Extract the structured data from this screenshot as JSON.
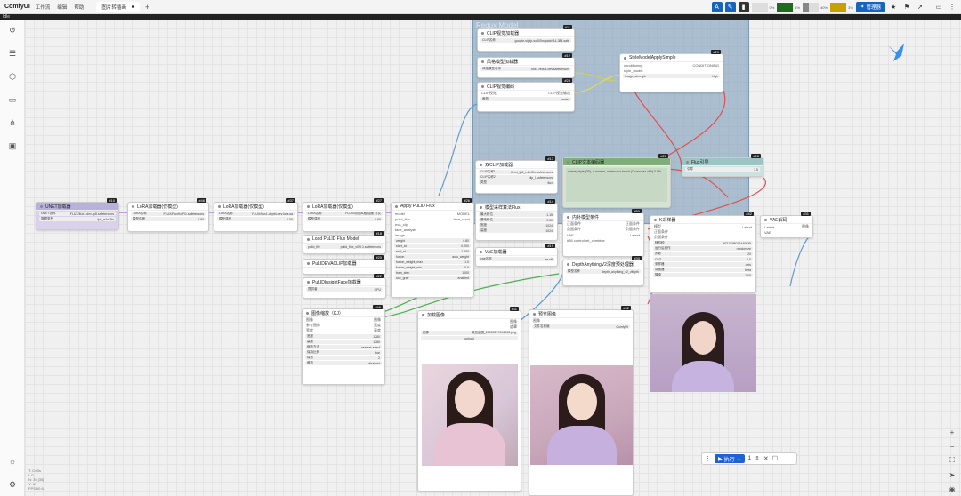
{
  "app": {
    "title": "ComfyUI",
    "menu": [
      "工作流",
      "编辑",
      "帮助"
    ],
    "tab": "图片转插画",
    "strip": "Idle"
  },
  "toolbar": {
    "manager": "管理器",
    "meters": [
      {
        "label": "0%",
        "pct": 0,
        "color": "#1e8e3e"
      },
      {
        "label": "1%",
        "pct": 100,
        "color": "#1e6b1e"
      },
      {
        "label": "40%",
        "pct": 40,
        "color": "#888"
      },
      {
        "label": "3%",
        "pct": 100,
        "color": "#c8a000"
      }
    ]
  },
  "group": {
    "title": "Redux Model"
  },
  "nodes": {
    "unet": {
      "id": "#10",
      "title": "UNET加载器",
      "w1l": "UNET名称",
      "w1v": "FLUX/flux1-dev-fp8.safetensors",
      "w2l": "数据类型",
      "w2v": "fp8_e4m3fn"
    },
    "lora1": {
      "id": "#46",
      "title": "LoRA加载器(仅模型)",
      "w1l": "LoRA名称",
      "w1v": "FLUX/FluxKoiFl1.safetensors",
      "w2l": "模型强度",
      "w2v": "0.60"
    },
    "lora2": {
      "id": "#37",
      "title": "LoRA加载器(仅模型)",
      "w1l": "LoRA名称",
      "w1v": "FLUX/flux1-depth-dev-lora.sa",
      "w2l": "模型强度",
      "w2v": "1.00"
    },
    "lora3": {
      "id": "#27",
      "title": "LoRA加载器(仅模型)",
      "w1l": "LoRA名称",
      "w1v": "FLUX/动漫风格 插画 写实",
      "w2l": "模型强度",
      "w2v": "0.60"
    },
    "pulidload": {
      "id": "#18",
      "title": "Load PuLID Flux Model",
      "w1l": "pulid_file",
      "w1v": "pulid_flux_v0.9.1.safetensors"
    },
    "evaclip": {
      "id": "#20",
      "title": "PuLIDEVACLIP加载器"
    },
    "insight": {
      "id": "#22",
      "title": "PuLIDInsightFace加载器",
      "w1l": "提供者",
      "w1v": "CPU"
    },
    "apply": {
      "id": "#26",
      "title": "Apply PuLID Flux",
      "tag": "1.626秒",
      "ws": [
        [
          "weight",
          "0.80"
        ],
        [
          "start_at",
          "0.000"
        ],
        [
          "end_at",
          "1.000"
        ],
        [
          "fusion",
          "auto_weight"
        ],
        [
          "fusion_weight_max",
          "1.0"
        ],
        [
          "fusion_weight_min",
          "0.0"
        ],
        [
          "train_step",
          "1000"
        ],
        [
          "use_gray",
          "enabled"
        ]
      ]
    },
    "clipload": {
      "id": "#11",
      "title": "CLIP视觉加载器",
      "w1l": "CLIP名称",
      "w1v": "google-siglip-so400m-patch14-384.safe"
    },
    "style": {
      "id": "#12",
      "title": "风格模型加载器",
      "w1l": "风格模型名称",
      "w1v": "flux1-redux-dev.safetensors"
    },
    "clipenc": {
      "id": "#23",
      "title": "CLIP视觉编码",
      "w1l": "裁剪",
      "w1v": "center"
    },
    "styleapply": {
      "id": "#29",
      "title": "StyleModelApplySimple",
      "tag": "#29 AdvancedReflux",
      "w1l": "image_strength",
      "w1v": "high"
    },
    "dualclip": {
      "id": "#13",
      "title": "双CLIP加载器",
      "ws": [
        [
          "CLIP名称1",
          "t5xxl_fp8_e4m3fn.safetensors"
        ],
        [
          "CLIP名称2",
          "clip_l.safetensors"
        ],
        [
          "类型",
          "flux"
        ]
      ]
    },
    "cliptext": {
      "id": "#21",
      "title": "CLIP文本编码器",
      "text": "anime_style (30), a woman, watercolor brush (Crossover of A) 0.9%"
    },
    "guidance": {
      "id": "#28",
      "title": "Flux引导",
      "w1l": "引导",
      "w1v": "3.5"
    },
    "sampler": {
      "id": "#14",
      "title": "模型采样算法Flux",
      "ws": [
        [
          "最大移位",
          "1.15"
        ],
        [
          "基础移位",
          "0.50"
        ],
        [
          "宽度",
          "1024"
        ],
        [
          "高度",
          "1024"
        ]
      ]
    },
    "vae": {
      "id": "#19",
      "title": "VAE加载器",
      "w1l": "vae名称",
      "w1v": "ae.sft"
    },
    "cnapply": {
      "id": "#50",
      "title": "内补模型条件",
      "tag": "0.30秒",
      "extra": "#36 controlnet_combine"
    },
    "depth": {
      "id": "#30",
      "title": "DepthAnythingV2深度预处理器",
      "w1l": "模型名称",
      "w1v": "depth_anything_v2_vitl.pth"
    },
    "ksampler": {
      "id": "#42",
      "title": "K采样器",
      "tag": "114.449秒",
      "ws": [
        [
          "随机种",
          "9713798012440635"
        ],
        [
          "运行后操作",
          "randomize"
        ],
        [
          "步数",
          "20"
        ],
        [
          "CFG",
          "1.0"
        ],
        [
          "采样器",
          "deis"
        ],
        [
          "调度器",
          "beta"
        ],
        [
          "降噪",
          "1.00"
        ]
      ]
    },
    "vaedec": {
      "id": "#31",
      "title": "VAE解码",
      "tag": "1.059秒"
    },
    "resize": {
      "id": "#46",
      "title": "图像缩放（KJ）",
      "tag": "0.205秒",
      "ws": [
        [
          "宽度",
          "1280"
        ],
        [
          "高度",
          "1280"
        ],
        [
          "缩放方法",
          "nearest-exact"
        ],
        [
          "保持比例",
          "true"
        ],
        [
          "除数",
          "2"
        ],
        [
          "裁剪",
          "disabled"
        ]
      ]
    },
    "loadimg": {
      "id": "#11",
      "title": "加载图像",
      "w1l": "图像",
      "w1v": "微信截图_20250217094813.png",
      "upload": "upload"
    },
    "preview1": {
      "id": "#32",
      "title": "预览图像",
      "tag": "0.025秒",
      "w1l": "文件名前缀",
      "w1v": "ComfyUI"
    }
  },
  "run": {
    "label": "执行",
    "count": "1"
  },
  "stats": [
    "T: 0.00s",
    "I: 0",
    "N: 35 [35]",
    "V: 67",
    "FPS:60.61"
  ]
}
